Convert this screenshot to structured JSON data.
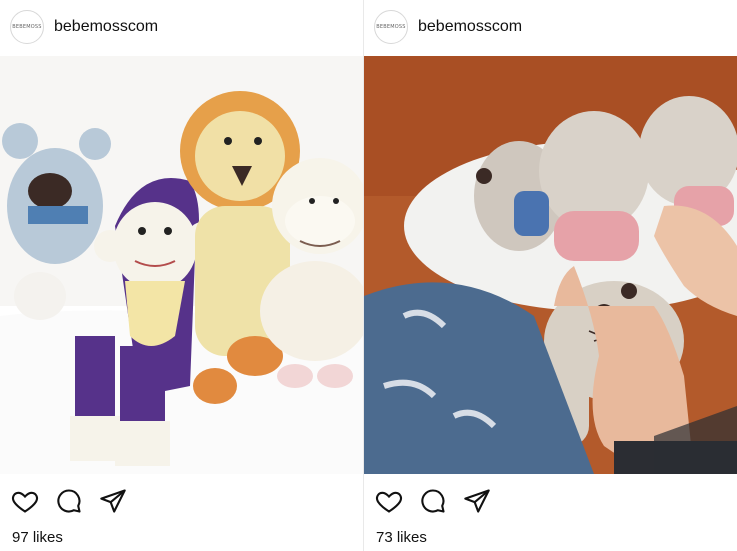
{
  "posts": [
    {
      "avatar_text": "BEBEMOSS",
      "username": "bebemosscom",
      "photo_alt": "Crochet toys: bear, purple monkey, lion, sheep",
      "likes": "97 likes",
      "icons": [
        "heart-icon",
        "comment-icon",
        "share-icon"
      ]
    },
    {
      "avatar_text": "BEBEMOSS",
      "username": "bebemosscom",
      "photo_alt": "Hands stitching a crochet toy",
      "likes": "73 likes",
      "icons": [
        "heart-icon",
        "comment-icon",
        "share-icon"
      ]
    }
  ]
}
